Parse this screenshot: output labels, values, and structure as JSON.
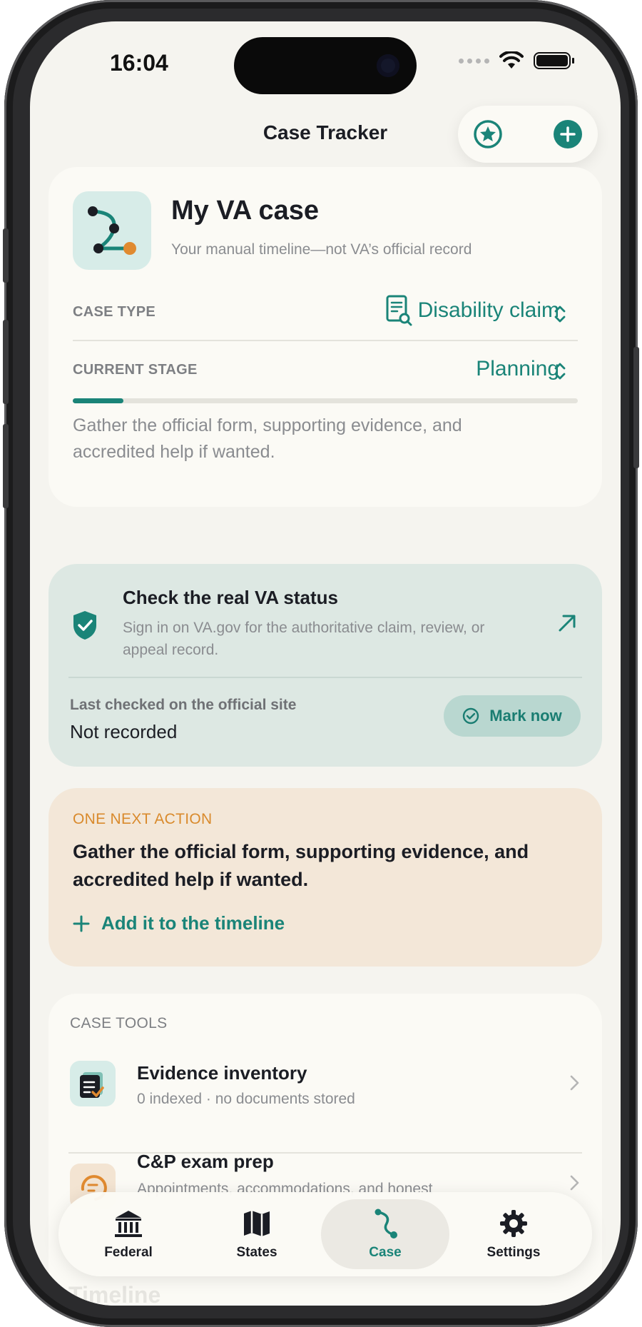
{
  "status_bar": {
    "time": "16:04"
  },
  "header": {
    "title": "Case Tracker",
    "favorite_icon": "star-circle-icon",
    "add_icon": "plus-circle-icon"
  },
  "case_card": {
    "title": "My VA case",
    "subtitle": "Your manual timeline—not VA’s official record",
    "case_type_label": "CASE TYPE",
    "case_type_value": "Disability claim",
    "current_stage_label": "CURRENT STAGE",
    "current_stage_value": "Planning",
    "stage_progress": 0.1,
    "stage_description": "Gather the official form, supporting evidence, and accredited help if wanted."
  },
  "status_card": {
    "title": "Check the real VA status",
    "description": "Sign in on VA.gov for the authoritative claim, review, or appeal record.",
    "last_checked_label": "Last checked on the official site",
    "last_checked_value": "Not recorded",
    "mark_button": "Mark now"
  },
  "next_action": {
    "label": "ONE NEXT ACTION",
    "text": "Gather the official form, supporting evidence, and accredited help if wanted.",
    "add_link": "Add it to the timeline"
  },
  "case_tools": {
    "label": "CASE TOOLS",
    "items": [
      {
        "title": "Evidence inventory",
        "subtitle": "0 indexed · no documents stored"
      },
      {
        "title": "C&P exam prep",
        "subtitle": "Appointments, accommodations, and honest"
      }
    ]
  },
  "timeline_heading": "Timeline",
  "tabs": [
    {
      "label": "Federal",
      "icon": "building-columns-icon"
    },
    {
      "label": "States",
      "icon": "map-icon"
    },
    {
      "label": "Case",
      "icon": "path-icon"
    },
    {
      "label": "Settings",
      "icon": "gear-icon"
    }
  ],
  "colors": {
    "accent": "#1a8478",
    "orange": "#d98a2c",
    "background": "#f5f4ef"
  }
}
